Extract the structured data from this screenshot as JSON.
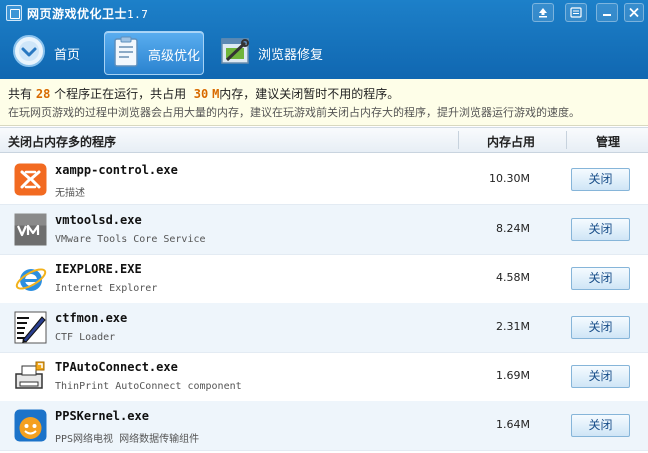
{
  "window": {
    "title": "网页游戏优化卫士",
    "version": "1.7"
  },
  "tabs": [
    {
      "label": "首页",
      "active": false
    },
    {
      "label": "高级优化",
      "active": true
    },
    {
      "label": "浏览器修复",
      "active": false
    }
  ],
  "summary": {
    "part1": "共有",
    "program_count": "28",
    "part2": "个程序正在运行，共占用",
    "memory": "30",
    "memory_unit": "M",
    "part3": "内存，建议关闭暂时不用的程序。",
    "line2": "在玩网页游戏的过程中浏览器会占用大量的内存，建议在玩游戏前关闭占内存大的程序，提升浏览器运行游戏的速度。"
  },
  "table": {
    "headers": {
      "name": "关闭占内存多的程序",
      "memory": "内存占用",
      "manage": "管理"
    },
    "close_label": "关闭",
    "rows": [
      {
        "name": "xampp-control.exe",
        "desc": "无描述",
        "memory": "10.30M",
        "icon": "xampp-icon"
      },
      {
        "name": "vmtoolsd.exe",
        "desc": "VMware Tools Core Service",
        "memory": "8.24M",
        "icon": "vmware-icon"
      },
      {
        "name": "IEXPLORE.EXE",
        "desc": "Internet Explorer",
        "memory": "4.58M",
        "icon": "internet-explorer-icon"
      },
      {
        "name": "ctfmon.exe",
        "desc": "CTF Loader",
        "memory": "2.31M",
        "icon": "ctf-loader-icon"
      },
      {
        "name": "TPAutoConnect.exe",
        "desc": "ThinPrint AutoConnect component",
        "memory": "1.69M",
        "icon": "thinprint-icon"
      },
      {
        "name": "PPSKernel.exe",
        "desc": "PPS网络电视 网络数据传输组件",
        "memory": "1.64M",
        "icon": "pps-icon"
      }
    ]
  },
  "colors": {
    "toolbar_blue": "#1876bf",
    "highlight_orange": "#d86a00",
    "summary_bg": "#fefee8",
    "row_alt_bg": "#eef5fb"
  }
}
